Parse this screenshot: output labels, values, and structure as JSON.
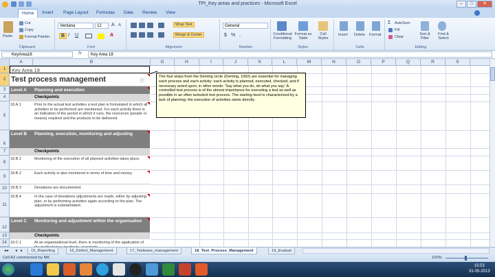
{
  "window": {
    "title": "TPI_Key areas and practices - Microsoft Excel",
    "controls": [
      "–",
      "□",
      "✕"
    ]
  },
  "ribbon": {
    "file_icon": "office-button",
    "tabs": [
      "Home",
      "Insert",
      "Page Layout",
      "Formulas",
      "Data",
      "Review",
      "View"
    ],
    "active_tab": "Home",
    "clipboard": {
      "paste": "Paste",
      "cut": "Cut",
      "copy": "Copy",
      "format_painter": "Format Painter",
      "label": "Clipboard"
    },
    "font": {
      "name": "Verdana",
      "size": "12",
      "bold": "B",
      "italic": "I",
      "underline": "U",
      "label": "Font"
    },
    "alignment": {
      "wrap_text": "Wrap Text",
      "merge_center": "Merge & Center",
      "label": "Alignment"
    },
    "number": {
      "format": "General",
      "label": "Number",
      "currency": "$",
      "percent": "%",
      "comma": ","
    },
    "styles": {
      "conditional": "Conditional Formatting",
      "format_table": "Format as Table",
      "cell_styles": "Cell Styles",
      "label": "Styles"
    },
    "cells": {
      "insert": "Insert",
      "delete": "Delete",
      "format": "Format",
      "label": "Cells"
    },
    "editing": {
      "autosum": "AutoSum",
      "fill": "Fill",
      "clear": "Clear",
      "sort": "Sort & Filter",
      "find": "Find & Select",
      "label": "Editing"
    }
  },
  "formula_bar": {
    "name_box": "KeyArea18",
    "fx": "fx",
    "content": "Key Area 18"
  },
  "columns": [
    "A",
    "B",
    "G",
    "H",
    "I",
    "J",
    "K",
    "L",
    "M",
    "N",
    "O",
    "P",
    "Q",
    "R",
    "S"
  ],
  "rows": [
    "1",
    "2",
    "3",
    "4",
    "5",
    "",
    "6",
    "7",
    "8",
    "9",
    "10",
    "11",
    "12",
    "13",
    "14",
    "15",
    "16"
  ],
  "cells": {
    "a1": "Key Area 18",
    "a2": "Test process management",
    "a3": "Level A",
    "b3": "Planning and execution",
    "b4": "Checkpoints",
    "a5": "18.A.1",
    "b5": "Prior to the actual test activities a test plan is formulated in which all activities to be performed are mentioned. For each activity there is an indication of the period in which it runs, the resources (people or means) required and the products to be delivered.",
    "a6": "Level B",
    "b6": "Planning, execution, monitoring and adjusting",
    "b7": "Checkpoints",
    "a8": "18.B.1",
    "b8": "Monitoring of the execution of all planned activities takes place.",
    "a9": "18.B.2",
    "b9": "Each activity is also monitored in terms of time and money.",
    "a10": "18.B.3",
    "b10": "Deviations are documented.",
    "a11": "18.B.4",
    "b11": "In the case of deviations adjustments are made, either by adjusting plan, or by performing activities again according to the plan. The adjustment is substantiated.",
    "a12": "Level C",
    "b12": "Monitoring and adjustment within the organisation",
    "b13": "Checkpoints",
    "a14": "18.C.1",
    "b14": "At an organisational level, there is monitoring of the application of the methodology (methods, standards"
  },
  "comment": "The four steps from the Deming circle (Deming, 1992) are essential for managing each process and each activity: each activity is planned, executed, checked, and if necessary acted upon; in other words: 'Say what you do, do what you say.' A controlled test process is of the utmost importance for executing a test as well as possible in an often turbulent test process. The starting level is characterized by a lack of planning; the execution of activities starts directly.",
  "sheet_tabs": [
    "15_Reporting",
    "16_Defect_Management",
    "17_Testware_management",
    "18_Test_Process_Management",
    "19_Evaluat"
  ],
  "active_sheet": "18_Test_Process_Management",
  "status": {
    "left": "Cell A2 commented by MK",
    "zoom": "100%"
  },
  "taskbar": {
    "time": "15:53",
    "date": "31-05-2013"
  }
}
